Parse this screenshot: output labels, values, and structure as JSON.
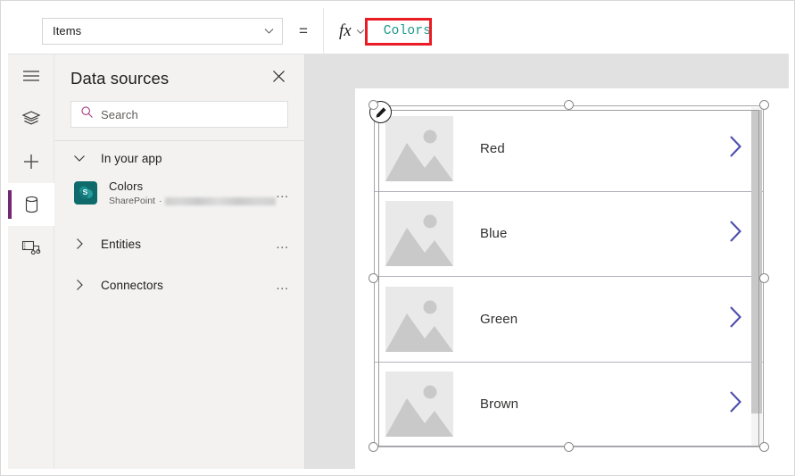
{
  "formula_bar": {
    "property_selector": {
      "value": "Items",
      "icon": "chevron-down-icon"
    },
    "equals_sign": "=",
    "fx_label": "fx",
    "formula_value": "Colors",
    "highlight_color": "#ea1c24",
    "formula_text_color": "#1b998b"
  },
  "rail": {
    "items": [
      {
        "name": "hamburger-menu",
        "icon": "hamburger-icon",
        "selected": false
      },
      {
        "name": "tree-view",
        "icon": "layers-icon",
        "selected": false
      },
      {
        "name": "insert",
        "icon": "plus-icon",
        "selected": false
      },
      {
        "name": "data-sources",
        "icon": "database-icon",
        "selected": true
      },
      {
        "name": "media",
        "icon": "media-icon",
        "selected": false
      }
    ],
    "selected_indicator_color": "#742774"
  },
  "panel": {
    "title": "Data sources",
    "close_icon": "close-icon",
    "search": {
      "placeholder": "Search",
      "icon": "search-icon",
      "icon_color": "#a4377f"
    },
    "groups": [
      {
        "label": "In your app",
        "expanded": true,
        "caret": "chevron-down-icon",
        "overflow": "…"
      },
      {
        "label": "Entities",
        "expanded": false,
        "caret": "chevron-right-icon",
        "overflow": "…"
      },
      {
        "label": "Connectors",
        "expanded": false,
        "caret": "chevron-right-icon",
        "overflow": "…"
      }
    ],
    "data_source": {
      "name": "Colors",
      "connector": "SharePoint",
      "separator": "·",
      "site_url_redacted": true,
      "icon": "sharepoint-icon",
      "icon_color": "#0f6b6b",
      "overflow": "…"
    }
  },
  "canvas": {
    "background_color": "#e1e1e1",
    "screen_background": "#ffffff",
    "gallery": {
      "selected": true,
      "edit_badge_icon": "pencil-icon",
      "chevron_color": "#4e4eae",
      "items": [
        {
          "label": "Red",
          "thumb_icon": "image-placeholder-icon",
          "chevron": "chevron-right-icon"
        },
        {
          "label": "Blue",
          "thumb_icon": "image-placeholder-icon",
          "chevron": "chevron-right-icon"
        },
        {
          "label": "Green",
          "thumb_icon": "image-placeholder-icon",
          "chevron": "chevron-right-icon"
        },
        {
          "label": "Brown",
          "thumb_icon": "image-placeholder-icon",
          "chevron": "chevron-right-icon"
        }
      ],
      "scrollbar_visible": true
    }
  }
}
